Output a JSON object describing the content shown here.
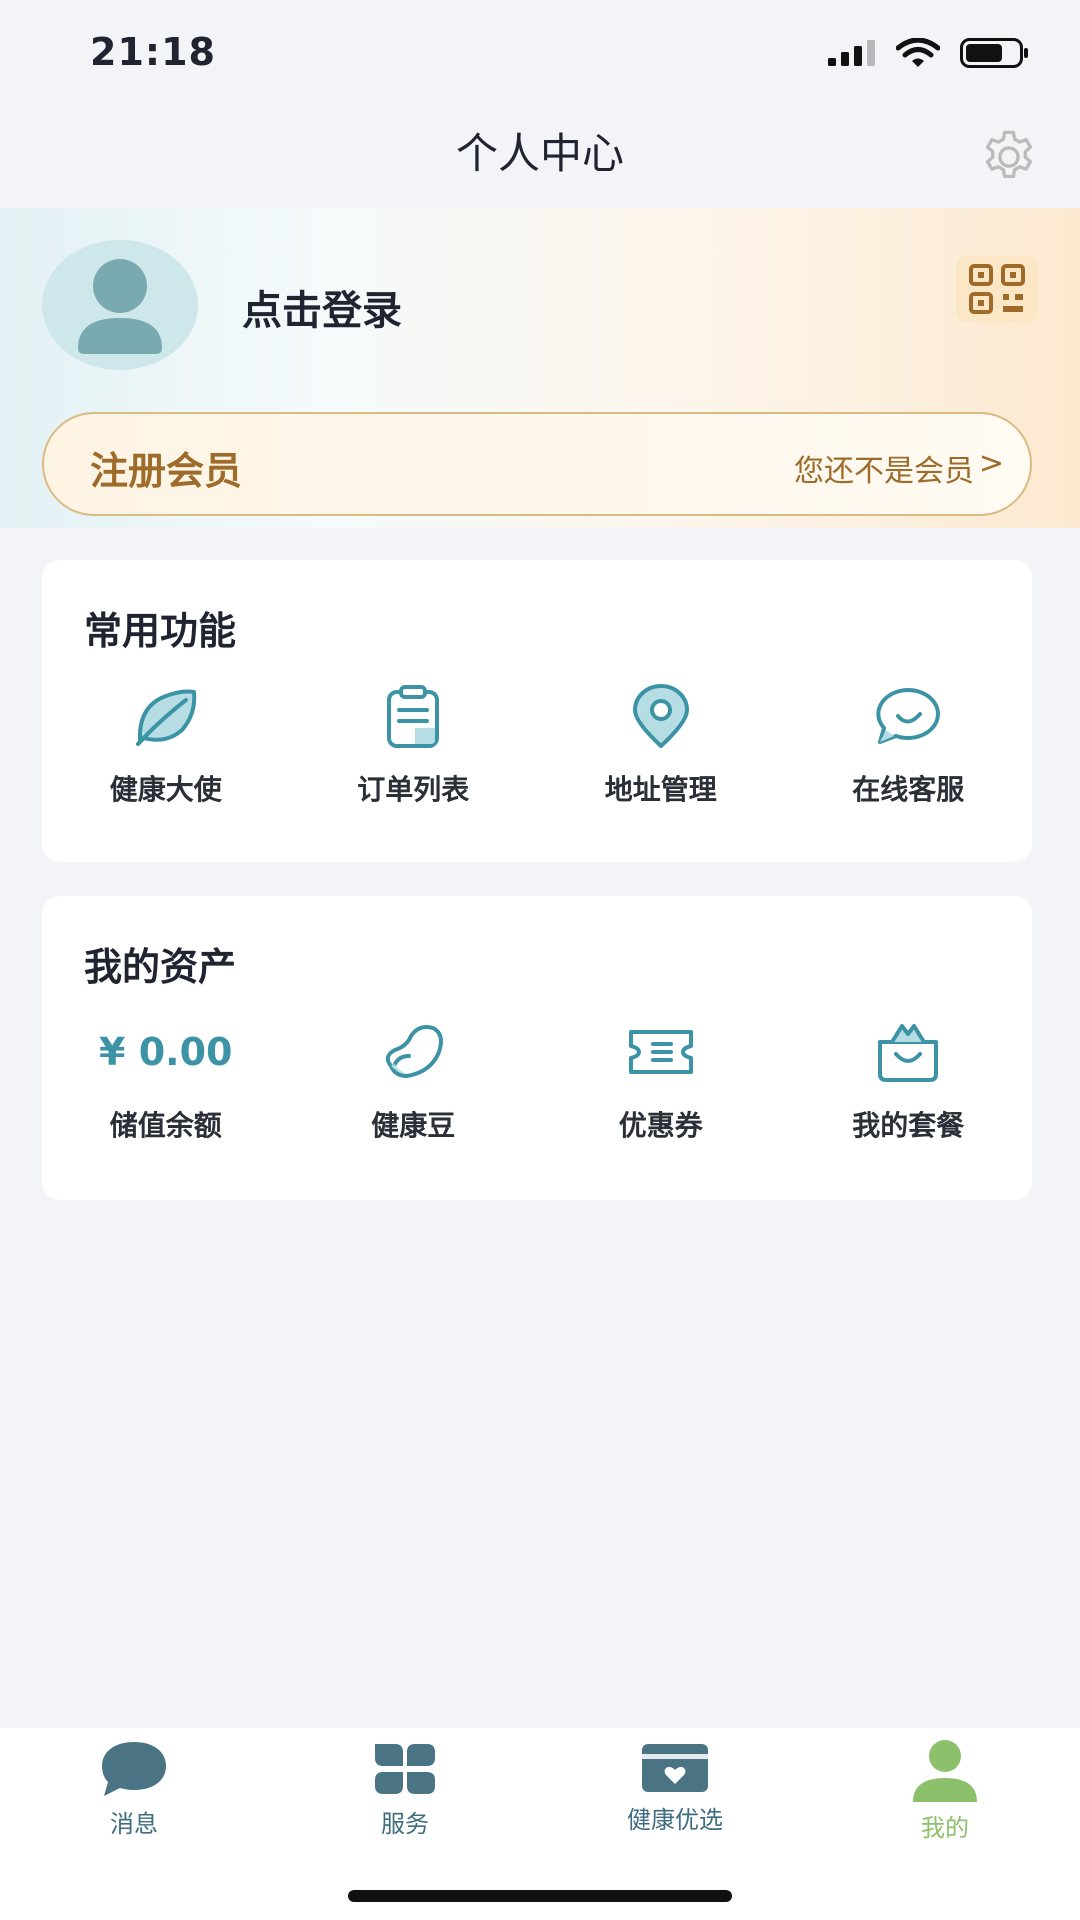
{
  "status_bar": {
    "time": "21:18"
  },
  "header": {
    "title": "个人中心"
  },
  "profile": {
    "login_text": "点击登录"
  },
  "membership": {
    "title": "注册会员",
    "status": "您还不是会员",
    "chevron": ">"
  },
  "common_functions": {
    "title": "常用功能",
    "items": [
      {
        "label": "健康大使",
        "icon": "leaf-icon"
      },
      {
        "label": "订单列表",
        "icon": "clipboard-icon"
      },
      {
        "label": "地址管理",
        "icon": "location-pin-icon"
      },
      {
        "label": "在线客服",
        "icon": "chat-bubble-icon"
      }
    ]
  },
  "assets": {
    "title": "我的资产",
    "balance_value": "¥ 0.00",
    "items": [
      {
        "label": "储值余额"
      },
      {
        "label": "健康豆",
        "icon": "bean-icon"
      },
      {
        "label": "优惠券",
        "icon": "coupon-icon"
      },
      {
        "label": "我的套餐",
        "icon": "gift-bag-icon"
      }
    ]
  },
  "tab_bar": {
    "items": [
      {
        "label": "消息",
        "icon": "message-icon"
      },
      {
        "label": "服务",
        "icon": "service-grid-icon"
      },
      {
        "label": "健康优选",
        "icon": "health-select-icon"
      },
      {
        "label": "我的",
        "icon": "profile-icon",
        "active": true
      }
    ]
  },
  "colors": {
    "accent": "#3d93a6",
    "gold": "#9e6b2a",
    "tab_icon": "#4a7384",
    "tab_active": "#8cc06a"
  }
}
